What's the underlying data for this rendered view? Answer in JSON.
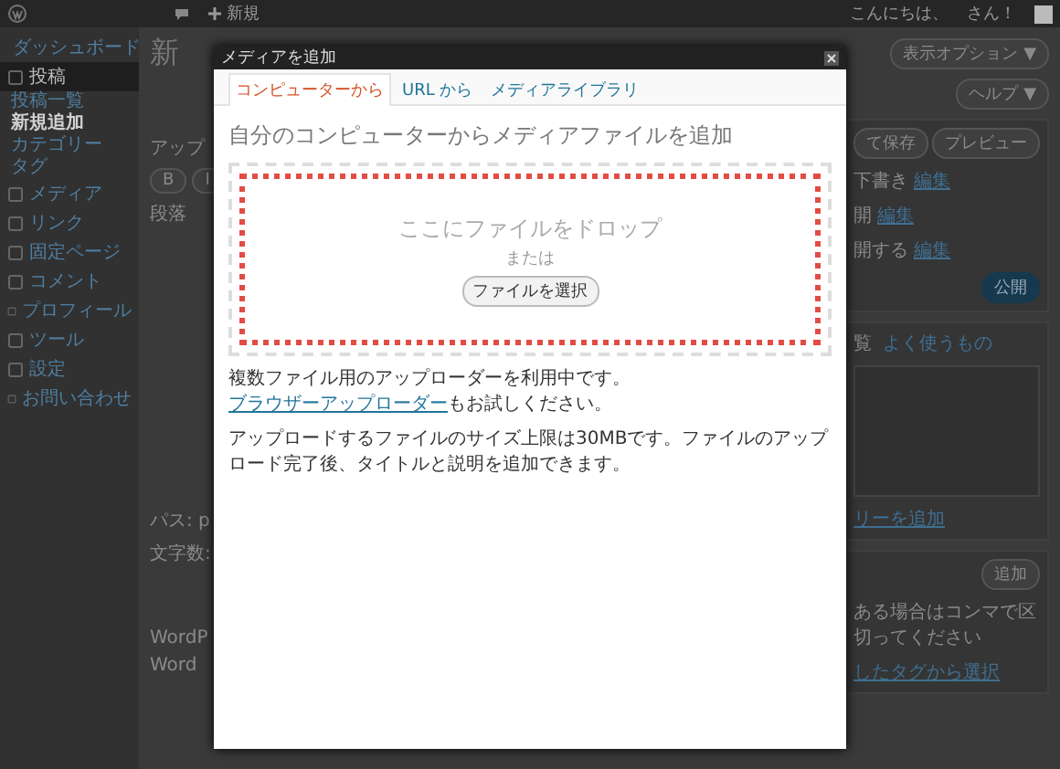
{
  "admin_bar": {
    "new_label": "新規",
    "greeting": "こんにちは、",
    "user_suffix": "さん！"
  },
  "sidebar": {
    "items": [
      {
        "label": "ダッシュボード",
        "selected": false
      },
      {
        "label": "投稿",
        "selected": true,
        "children": [
          {
            "label": "投稿一覧",
            "selected": false
          },
          {
            "label": "新規追加",
            "selected": true
          },
          {
            "label": "カテゴリー",
            "selected": false
          },
          {
            "label": "タグ",
            "selected": false
          }
        ]
      },
      {
        "label": "メディア",
        "selected": false
      },
      {
        "label": "リンク",
        "selected": false
      },
      {
        "label": "固定ページ",
        "selected": false
      },
      {
        "label": "コメント",
        "selected": false
      },
      {
        "label": "プロフィール",
        "selected": false
      },
      {
        "label": "ツール",
        "selected": false
      },
      {
        "label": "設定",
        "selected": false
      },
      {
        "label": "お問い合わせ",
        "selected": false
      }
    ]
  },
  "page": {
    "title": "新",
    "screen_options": "表示オプション ▼",
    "help": "ヘルプ ▼",
    "editor": {
      "upload_label": "アップ",
      "format_buttons": [
        "B",
        "I"
      ],
      "format_select": "段落",
      "path": "パス: p",
      "word_count": "文字数:"
    },
    "box_title": "WordP",
    "box_text": "Word"
  },
  "publish_box": {
    "save_button": "て保存",
    "preview_button": "プレビュー",
    "rows": [
      {
        "label": "下書き",
        "link": "編集"
      },
      {
        "label": "開",
        "link": "編集"
      },
      {
        "label": "開する",
        "link": "編集"
      }
    ],
    "publish_button": "公開"
  },
  "category_box": {
    "tabs": [
      {
        "label": "覧",
        "selected": true
      },
      {
        "label": "よく使うもの",
        "selected": false
      }
    ],
    "add_link": "リーを追加"
  },
  "tag_box": {
    "add_button": "追加",
    "hint": "ある場合はコンマで区切ってください",
    "choose_link": "したタグから選択"
  },
  "modal": {
    "title": "メディアを追加",
    "tabs": [
      {
        "label": "コンピューターから",
        "selected": true
      },
      {
        "label": "URL から",
        "selected": false
      },
      {
        "label": "メディアライブラリ",
        "selected": false
      }
    ],
    "heading": "自分のコンピューターからメディアファイルを追加",
    "drop_text": "ここにファイルをドロップ",
    "or_text": "または",
    "select_button": "ファイルを選択",
    "note": {
      "before": "複数ファイル用のアップローダーを利用中です。",
      "link": "ブラウザーアップローダー",
      "after": "もお試しください。"
    },
    "limit_note": "アップロードするファイルのサイズ上限は30MBです。ファイルのアップロード完了後、タイトルと説明を追加できます。"
  }
}
